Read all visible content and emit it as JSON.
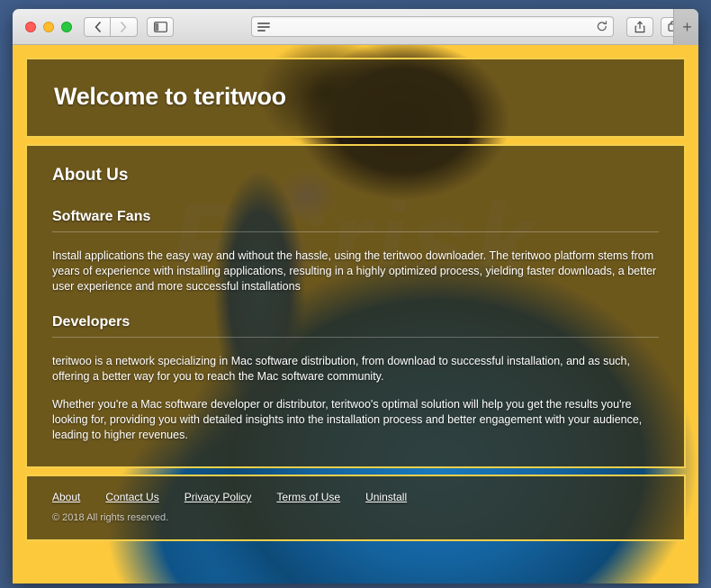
{
  "browser": {
    "traffic_lights": [
      "close",
      "minimize",
      "zoom"
    ],
    "nav": {
      "back_icon": "chevron-left-icon",
      "forward_icon": "chevron-right-icon",
      "sidebar_icon": "sidebar-toggle-icon"
    },
    "address_bar": {
      "value": "",
      "placeholder": "",
      "reader_icon": "reader-view-icon",
      "reload_icon": "reload-icon"
    },
    "right_buttons": {
      "share_icon": "share-icon",
      "tabs_icon": "show-all-tabs-icon"
    },
    "new_tab_label": "+"
  },
  "page": {
    "watermark": "PCrisk",
    "hero": {
      "title": "Welcome to teritwoo"
    },
    "about": {
      "heading": "About Us",
      "sections": [
        {
          "heading": "Software Fans",
          "paragraphs": [
            "Install applications the easy way and without the hassle, using the teritwoo downloader. The teritwoo platform stems from years of experience with installing applications, resulting in a highly optimized process, yielding faster downloads, a better user experience and more successful installations"
          ]
        },
        {
          "heading": "Developers",
          "paragraphs": [
            "teritwoo is a network specializing in Mac software distribution, from download to successful installation, and as such, offering a better way for you to reach the Mac software community.",
            "Whether you're a Mac software developer or distributor, teritwoo's optimal solution will help you get the results you're looking for, providing you with detailed insights into the installation process and better engagement with your audience, leading to higher revenues."
          ]
        }
      ]
    },
    "footer": {
      "links": [
        {
          "label": "About"
        },
        {
          "label": "Contact Us"
        },
        {
          "label": "Privacy Policy"
        },
        {
          "label": "Terms of Use"
        },
        {
          "label": "Uninstall"
        }
      ],
      "copyright": "© 2018 All rights reserved."
    }
  },
  "colors": {
    "page_background": "#fcc93c",
    "panel_border": "#f5cf4b",
    "panel_fill": "rgba(54,44,16,.72)",
    "desktop": "#3f5d8b",
    "text": "#ffffff"
  }
}
